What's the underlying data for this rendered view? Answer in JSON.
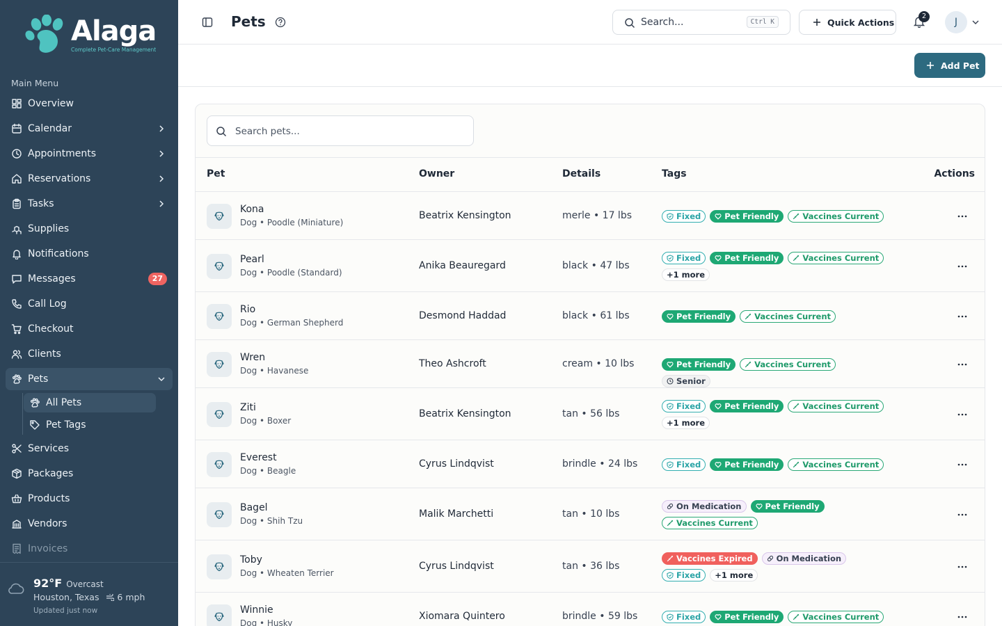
{
  "brand": {
    "name": "Alaga",
    "tagline": "Complete Pet-Care Management"
  },
  "sidebar": {
    "heading": "Main Menu",
    "items": [
      {
        "label": "Overview",
        "icon": "dashboard-icon"
      },
      {
        "label": "Calendar",
        "icon": "calendar-icon",
        "expandable": true
      },
      {
        "label": "Appointments",
        "icon": "clock-icon",
        "expandable": true
      },
      {
        "label": "Reservations",
        "icon": "home-icon",
        "expandable": true
      },
      {
        "label": "Tasks",
        "icon": "clipboard-icon",
        "expandable": true
      },
      {
        "label": "Supplies",
        "icon": "boxes-icon"
      },
      {
        "label": "Notifications",
        "icon": "bell-icon"
      },
      {
        "label": "Messages",
        "icon": "message-icon",
        "badge": "27"
      },
      {
        "label": "Call Log",
        "icon": "phone-icon"
      },
      {
        "label": "Checkout",
        "icon": "cart-icon"
      },
      {
        "label": "Clients",
        "icon": "users-icon"
      },
      {
        "label": "Pets",
        "icon": "paw-icon",
        "active": true,
        "expanded": true
      },
      {
        "label": "Services",
        "icon": "scissors-icon"
      },
      {
        "label": "Packages",
        "icon": "package-icon"
      },
      {
        "label": "Products",
        "icon": "basket-icon"
      },
      {
        "label": "Vendors",
        "icon": "building-icon"
      },
      {
        "label": "Invoices",
        "icon": "receipt-icon"
      }
    ],
    "pets_sub": [
      {
        "label": "All Pets",
        "icon": "paw-icon",
        "active": true
      },
      {
        "label": "Pet Tags",
        "icon": "tag-icon"
      }
    ]
  },
  "weather": {
    "temp": "92°F",
    "condition": "Overcast",
    "location": "Houston, Texas",
    "wind": "6 mph",
    "updated": "Updated just now"
  },
  "topbar": {
    "title": "Pets",
    "search_placeholder": "Search...",
    "search_shortcut": "Ctrl K",
    "quick_actions": "Quick Actions",
    "notification_count": "2",
    "avatar_initial": "J"
  },
  "actions": {
    "add_pet": "Add Pet"
  },
  "table": {
    "search_placeholder": "Search pets...",
    "columns": [
      "Pet",
      "Owner",
      "Details",
      "Tags",
      "Actions"
    ],
    "rows": [
      {
        "name": "Kona",
        "breed": "Dog • Poodle (Miniature)",
        "owner": "Beatrix Kensington",
        "details": "merle • 17 lbs",
        "tags": [
          [
            "fixed",
            "Fixed"
          ],
          [
            "friendly",
            "Pet Friendly"
          ],
          [
            "vacc",
            "Vaccines Current"
          ]
        ]
      },
      {
        "name": "Pearl",
        "breed": "Dog • Poodle (Standard)",
        "owner": "Anika Beauregard",
        "details": "black • 47 lbs",
        "tags": [
          [
            "fixed",
            "Fixed"
          ],
          [
            "friendly",
            "Pet Friendly"
          ],
          [
            "vacc",
            "Vaccines Current"
          ],
          [
            "more",
            "+1 more"
          ]
        ]
      },
      {
        "name": "Rio",
        "breed": "Dog • German Shepherd",
        "owner": "Desmond Haddad",
        "details": "black • 61 lbs",
        "tags": [
          [
            "friendly",
            "Pet Friendly"
          ],
          [
            "vacc",
            "Vaccines Current"
          ]
        ]
      },
      {
        "name": "Wren",
        "breed": "Dog • Havanese",
        "owner": "Theo Ashcroft",
        "details": "cream • 10 lbs",
        "tags": [
          [
            "friendly",
            "Pet Friendly"
          ],
          [
            "vacc",
            "Vaccines Current"
          ],
          [
            "senior",
            "Senior"
          ]
        ]
      },
      {
        "name": "Ziti",
        "breed": "Dog • Boxer",
        "owner": "Beatrix Kensington",
        "details": "tan • 56 lbs",
        "tags": [
          [
            "fixed",
            "Fixed"
          ],
          [
            "friendly",
            "Pet Friendly"
          ],
          [
            "vacc",
            "Vaccines Current"
          ],
          [
            "more",
            "+1 more"
          ]
        ]
      },
      {
        "name": "Everest",
        "breed": "Dog • Beagle",
        "owner": "Cyrus Lindqvist",
        "details": "brindle • 24 lbs",
        "tags": [
          [
            "fixed",
            "Fixed"
          ],
          [
            "friendly",
            "Pet Friendly"
          ],
          [
            "vacc",
            "Vaccines Current"
          ]
        ]
      },
      {
        "name": "Bagel",
        "breed": "Dog • Shih Tzu",
        "owner": "Malik Marchetti",
        "details": "tan • 10 lbs",
        "tags": [
          [
            "med",
            "On Medication"
          ],
          [
            "friendly",
            "Pet Friendly"
          ],
          [
            "vacc",
            "Vaccines Current"
          ]
        ]
      },
      {
        "name": "Toby",
        "breed": "Dog • Wheaten Terrier",
        "owner": "Cyrus Lindqvist",
        "details": "tan • 36 lbs",
        "tags": [
          [
            "expired",
            "Vaccines Expired"
          ],
          [
            "med",
            "On Medication"
          ],
          [
            "fixed",
            "Fixed"
          ],
          [
            "more",
            "+1 more"
          ]
        ]
      },
      {
        "name": "Winnie",
        "breed": "Dog • Husky",
        "owner": "Xiomara Quintero",
        "details": "brindle • 59 lbs",
        "tags": [
          [
            "fixed",
            "Fixed"
          ],
          [
            "friendly",
            "Pet Friendly"
          ],
          [
            "vacc",
            "Vaccines Current"
          ]
        ]
      }
    ]
  },
  "colors": {
    "sidebar_bg": "#2d4458",
    "primary": "#2d6a80",
    "friendly": "#1ea874",
    "fixed": "#2aa4a6",
    "expired": "#f0605d",
    "badge": "#ef6461"
  }
}
